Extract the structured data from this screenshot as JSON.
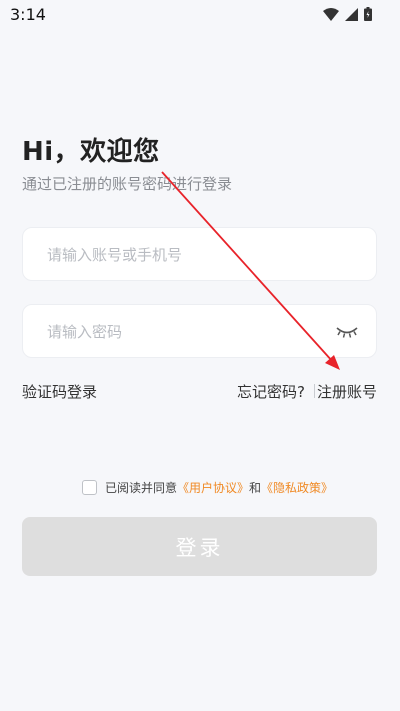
{
  "status_bar": {
    "time": "3:14",
    "icons": [
      "wifi-icon",
      "cellular-signal-icon",
      "battery-icon"
    ]
  },
  "login": {
    "greeting": "Hi，欢迎您",
    "subtitle": "通过已注册的账号密码进行登录",
    "account_placeholder": "请输入账号或手机号",
    "account_value": "",
    "password_placeholder": "请输入密码",
    "password_value": "",
    "password_toggle_icon": "eye-closed-icon",
    "sms_login_label": "验证码登录",
    "forgot_password_label": "忘记密码?",
    "register_label": "注册账号",
    "agreement_prefix": "已阅读并同意",
    "user_agreement_label": "《用户协议》",
    "agreement_and": "和",
    "privacy_policy_label": "《隐私政策》",
    "agreement_checked": false,
    "login_button_label": "登录"
  },
  "colors": {
    "background": "#f6f7fa",
    "link_accent": "#f08a25",
    "button_disabled": "#dedede",
    "annotation_arrow": "#e8232a"
  }
}
